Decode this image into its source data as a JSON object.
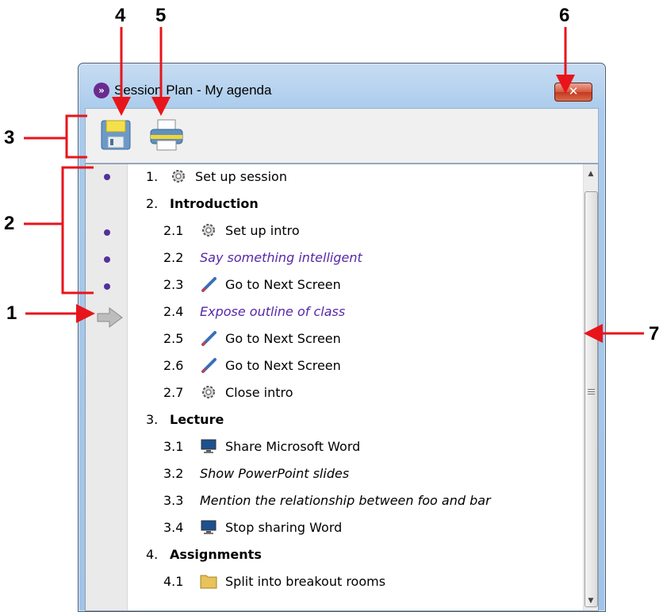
{
  "window": {
    "title": "Session Plan - My agenda",
    "app_icon_glyph": "»",
    "close_glyph": "✕"
  },
  "toolbar": {
    "buttons": [
      {
        "name": "save",
        "icon": "floppy-disk-icon"
      },
      {
        "name": "print",
        "icon": "printer-icon"
      }
    ]
  },
  "agenda": {
    "items": [
      {
        "num": "1.",
        "text": "Set up session",
        "icon": "gear-icon",
        "style": "normal",
        "level": 1
      },
      {
        "num": "2.",
        "text": "Introduction",
        "icon": "",
        "style": "bold",
        "level": 1
      },
      {
        "num": "2.1",
        "text": "Set up intro",
        "icon": "gear-icon",
        "style": "normal",
        "level": 2
      },
      {
        "num": "2.2",
        "text": "Say something intelligent",
        "icon": "",
        "style": "purple-italic",
        "level": 2
      },
      {
        "num": "2.3",
        "text": "Go to Next Screen",
        "icon": "pen-icon",
        "style": "normal",
        "level": 2
      },
      {
        "num": "2.4",
        "text": "Expose outline of class",
        "icon": "",
        "style": "purple-italic",
        "level": 2
      },
      {
        "num": "2.5",
        "text": "Go to Next Screen",
        "icon": "pen-icon",
        "style": "normal",
        "level": 2
      },
      {
        "num": "2.6",
        "text": "Go to Next Screen",
        "icon": "pen-icon",
        "style": "normal",
        "level": 2
      },
      {
        "num": "2.7",
        "text": "Close intro",
        "icon": "gear-icon",
        "style": "normal",
        "level": 2
      },
      {
        "num": "3.",
        "text": "Lecture",
        "icon": "",
        "style": "bold",
        "level": 1
      },
      {
        "num": "3.1",
        "text": "Share Microsoft Word",
        "icon": "monitor-icon",
        "style": "normal",
        "level": 2
      },
      {
        "num": "3.2",
        "text": "Show PowerPoint slides",
        "icon": "",
        "style": "italic",
        "level": 2
      },
      {
        "num": "3.3",
        "text": "Mention the relationship between foo and bar",
        "icon": "",
        "style": "italic",
        "level": 2
      },
      {
        "num": "3.4",
        "text": "Stop sharing Word",
        "icon": "monitor-icon",
        "style": "normal",
        "level": 2
      },
      {
        "num": "4.",
        "text": "Assignments",
        "icon": "",
        "style": "bold",
        "level": 1
      },
      {
        "num": "4.1",
        "text": "Split into breakout rooms",
        "icon": "folder-icon",
        "style": "normal",
        "level": 2
      }
    ],
    "completed_indices": [
      0,
      2,
      3,
      4
    ],
    "current_index": 5
  },
  "colors": {
    "accent_purple": "#54309a",
    "callout_red": "#e8141b",
    "close_red": "#d5583f"
  },
  "callouts": [
    "1",
    "2",
    "3",
    "4",
    "5",
    "6",
    "7"
  ]
}
